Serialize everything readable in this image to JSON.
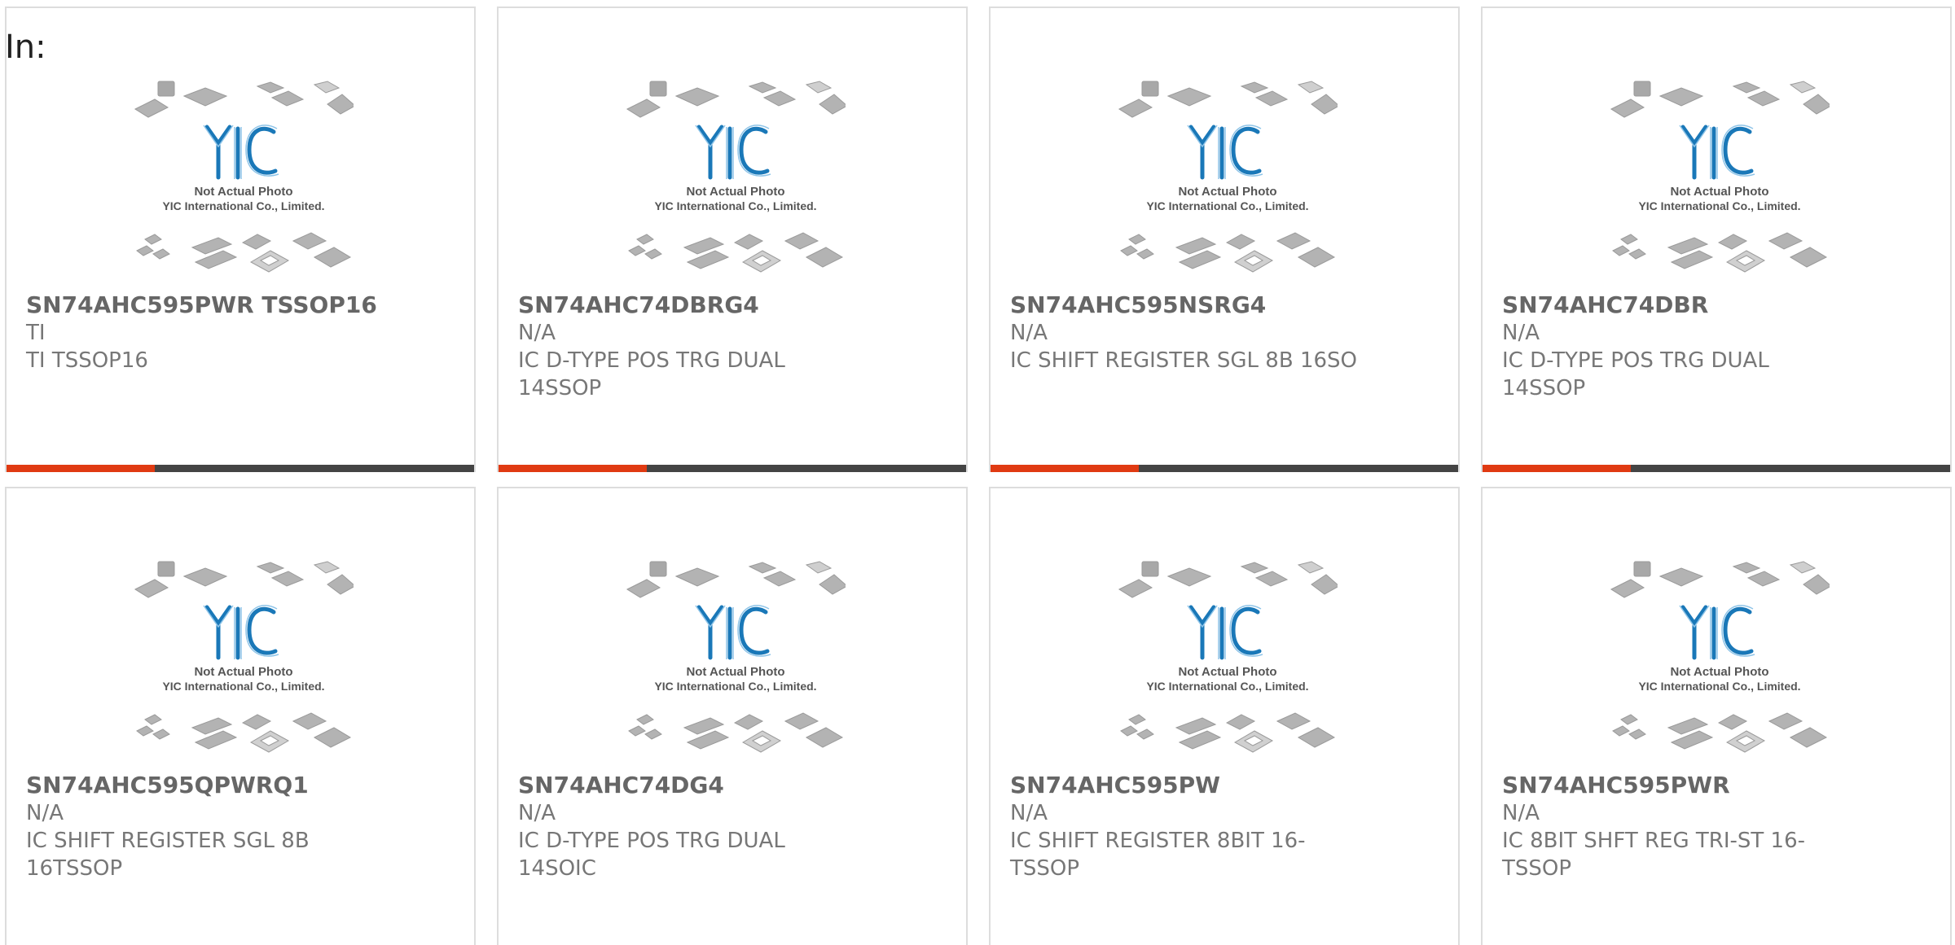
{
  "header": {
    "label": "In:"
  },
  "photo": {
    "caption_line1": "Not Actual Photo",
    "caption_line2": "YIC International Co., Limited.",
    "logo_text": "YIC"
  },
  "colors": {
    "accent": "#e03a12",
    "bar": "#444444",
    "logo": "#1a78b8",
    "border": "#dddddd"
  },
  "products": [
    {
      "title": "SN74AHC595PWR TSSOP16",
      "brand": "TI",
      "desc_line1": "TI TSSOP16",
      "desc_line2": ""
    },
    {
      "title": "SN74AHC74DBRG4",
      "brand": "N/A",
      "desc_line1": "IC D-TYPE POS TRG DUAL",
      "desc_line2": "14SSOP"
    },
    {
      "title": "SN74AHC595NSRG4",
      "brand": "N/A",
      "desc_line1": "IC SHIFT REGISTER SGL 8B 16SO",
      "desc_line2": ""
    },
    {
      "title": "SN74AHC74DBR",
      "brand": "N/A",
      "desc_line1": "IC D-TYPE POS TRG DUAL",
      "desc_line2": "14SSOP"
    },
    {
      "title": "SN74AHC595QPWRQ1",
      "brand": "N/A",
      "desc_line1": "IC SHIFT REGISTER SGL 8B",
      "desc_line2": "16TSSOP"
    },
    {
      "title": "SN74AHC74DG4",
      "brand": "N/A",
      "desc_line1": "IC D-TYPE POS TRG DUAL",
      "desc_line2": "14SOIC"
    },
    {
      "title": "SN74AHC595PW",
      "brand": "N/A",
      "desc_line1": "IC SHIFT REGISTER 8BIT 16-",
      "desc_line2": "TSSOP"
    },
    {
      "title": "SN74AHC595PWR",
      "brand": "N/A",
      "desc_line1": "IC 8BIT SHFT REG TRI-ST 16-",
      "desc_line2": "TSSOP"
    }
  ]
}
